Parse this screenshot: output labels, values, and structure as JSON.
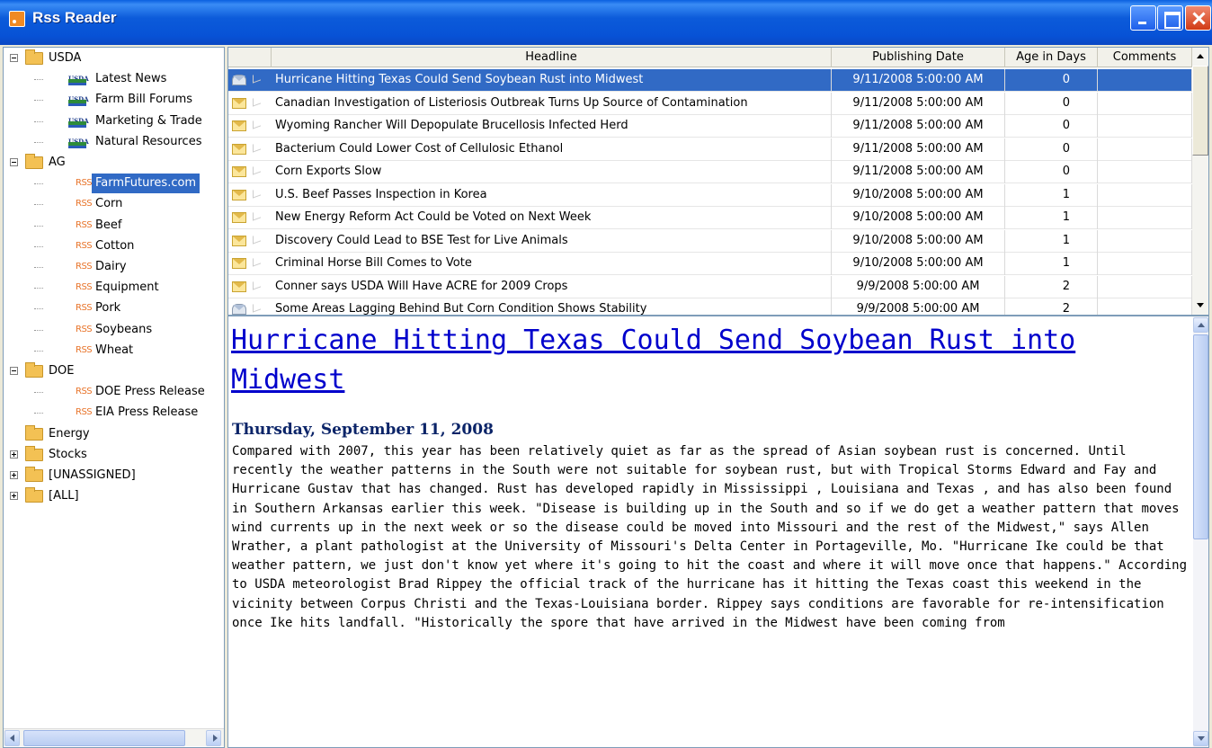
{
  "window": {
    "title": "Rss Reader"
  },
  "sidebar": {
    "nodes": [
      {
        "label": "USDA",
        "type": "folder",
        "level": 0,
        "expander": "minus"
      },
      {
        "label": "Latest News",
        "type": "usda",
        "level": 1
      },
      {
        "label": "Farm Bill Forums",
        "type": "usda",
        "level": 1
      },
      {
        "label": "Marketing & Trade",
        "type": "usda",
        "level": 1
      },
      {
        "label": "Natural Resources",
        "type": "usda",
        "level": 1
      },
      {
        "label": "AG",
        "type": "folder",
        "level": 0,
        "expander": "minus"
      },
      {
        "label": "FarmFutures.com",
        "type": "rss",
        "level": 1,
        "selected": true
      },
      {
        "label": "Corn",
        "type": "rss",
        "level": 1
      },
      {
        "label": "Beef",
        "type": "rss",
        "level": 1
      },
      {
        "label": "Cotton",
        "type": "rss",
        "level": 1
      },
      {
        "label": "Dairy",
        "type": "rss",
        "level": 1
      },
      {
        "label": "Equipment",
        "type": "rss",
        "level": 1
      },
      {
        "label": "Pork",
        "type": "rss",
        "level": 1
      },
      {
        "label": "Soybeans",
        "type": "rss",
        "level": 1
      },
      {
        "label": "Wheat",
        "type": "rss",
        "level": 1
      },
      {
        "label": "DOE",
        "type": "folder",
        "level": 0,
        "expander": "minus"
      },
      {
        "label": "DOE Press Release",
        "type": "rss",
        "level": 1
      },
      {
        "label": "EIA Press Release",
        "type": "rss",
        "level": 1
      },
      {
        "label": "Energy",
        "type": "folder",
        "level": 0,
        "expander": "none"
      },
      {
        "label": "Stocks",
        "type": "folder",
        "level": 0,
        "expander": "plus"
      },
      {
        "label": "[UNASSIGNED]",
        "type": "folder",
        "level": 0,
        "expander": "plus"
      },
      {
        "label": "[ALL]",
        "type": "folder",
        "level": 0,
        "expander": "plus"
      }
    ],
    "usda_badge": "USDA",
    "rss_badge": "RSS"
  },
  "grid": {
    "columns": {
      "headline": "Headline",
      "date": "Publishing Date",
      "age": "Age in Days",
      "comments": "Comments"
    },
    "rows": [
      {
        "headline": "Hurricane Hitting Texas Could Send Soybean Rust into Midwest",
        "date": "9/11/2008 5:00:00 AM",
        "age": "0",
        "comments": "",
        "read": true,
        "selected": true
      },
      {
        "headline": "Canadian Investigation of Listeriosis Outbreak Turns Up Source of Contamination",
        "date": "9/11/2008 5:00:00 AM",
        "age": "0",
        "comments": "",
        "read": false
      },
      {
        "headline": "Wyoming Rancher Will Depopulate Brucellosis Infected Herd",
        "date": "9/11/2008 5:00:00 AM",
        "age": "0",
        "comments": "",
        "read": false
      },
      {
        "headline": "Bacterium Could Lower Cost of Cellulosic Ethanol",
        "date": "9/11/2008 5:00:00 AM",
        "age": "0",
        "comments": "",
        "read": false
      },
      {
        "headline": "Corn Exports Slow",
        "date": "9/11/2008 5:00:00 AM",
        "age": "0",
        "comments": "",
        "read": false
      },
      {
        "headline": "U.S. Beef Passes Inspection in Korea",
        "date": "9/10/2008 5:00:00 AM",
        "age": "1",
        "comments": "",
        "read": false
      },
      {
        "headline": "New Energy Reform Act Could be Voted on Next Week",
        "date": "9/10/2008 5:00:00 AM",
        "age": "1",
        "comments": "",
        "read": false
      },
      {
        "headline": "Discovery Could Lead to BSE Test for Live Animals",
        "date": "9/10/2008 5:00:00 AM",
        "age": "1",
        "comments": "",
        "read": false
      },
      {
        "headline": "Criminal Horse Bill Comes to Vote",
        "date": "9/10/2008 5:00:00 AM",
        "age": "1",
        "comments": "",
        "read": false
      },
      {
        "headline": "Conner says USDA Will Have ACRE for 2009 Crops",
        "date": "9/9/2008 5:00:00 AM",
        "age": "2",
        "comments": "",
        "read": false
      },
      {
        "headline": "Some Areas Lagging Behind But Corn Condition Shows Stability",
        "date": "9/9/2008 5:00:00 AM",
        "age": "2",
        "comments": "",
        "read": true
      }
    ]
  },
  "article": {
    "title": "Hurricane Hitting Texas Could Send Soybean Rust into Midwest",
    "date": "Thursday, September 11, 2008",
    "body": "Compared with 2007, this year has been relatively quiet as far as the spread of Asian soybean rust is concerned. Until recently the weather patterns in the South were not suitable for soybean rust, but with Tropical Storms Edward and Fay and Hurricane Gustav that has changed. Rust has developed rapidly in Mississippi , Louisiana and Texas , and has also been found in Southern Arkansas earlier this week. \"Disease is building up in the South and so if we do get a weather pattern that moves wind currents up in the next week or so the disease could be moved into Missouri and the rest of the Midwest,\" says Allen Wrather, a plant pathologist at the University of Missouri's Delta Center in Portageville, Mo. \"Hurricane Ike could be that weather pattern, we just don't know yet where it's going to hit the coast and where it will move once that happens.\" According to USDA meteorologist Brad Rippey the official track of the hurricane has it hitting the Texas coast this weekend in the vicinity between Corpus Christi and the Texas-Louisiana border. Rippey says conditions are favorable for re-intensification once Ike hits landfall. \"Historically the spore that have arrived in the Midwest have been coming from"
  },
  "colors": {
    "titlebar": "#0752D6",
    "selection": "#316AC5",
    "link": "#0000CC",
    "date_heading": "#0B2468"
  }
}
